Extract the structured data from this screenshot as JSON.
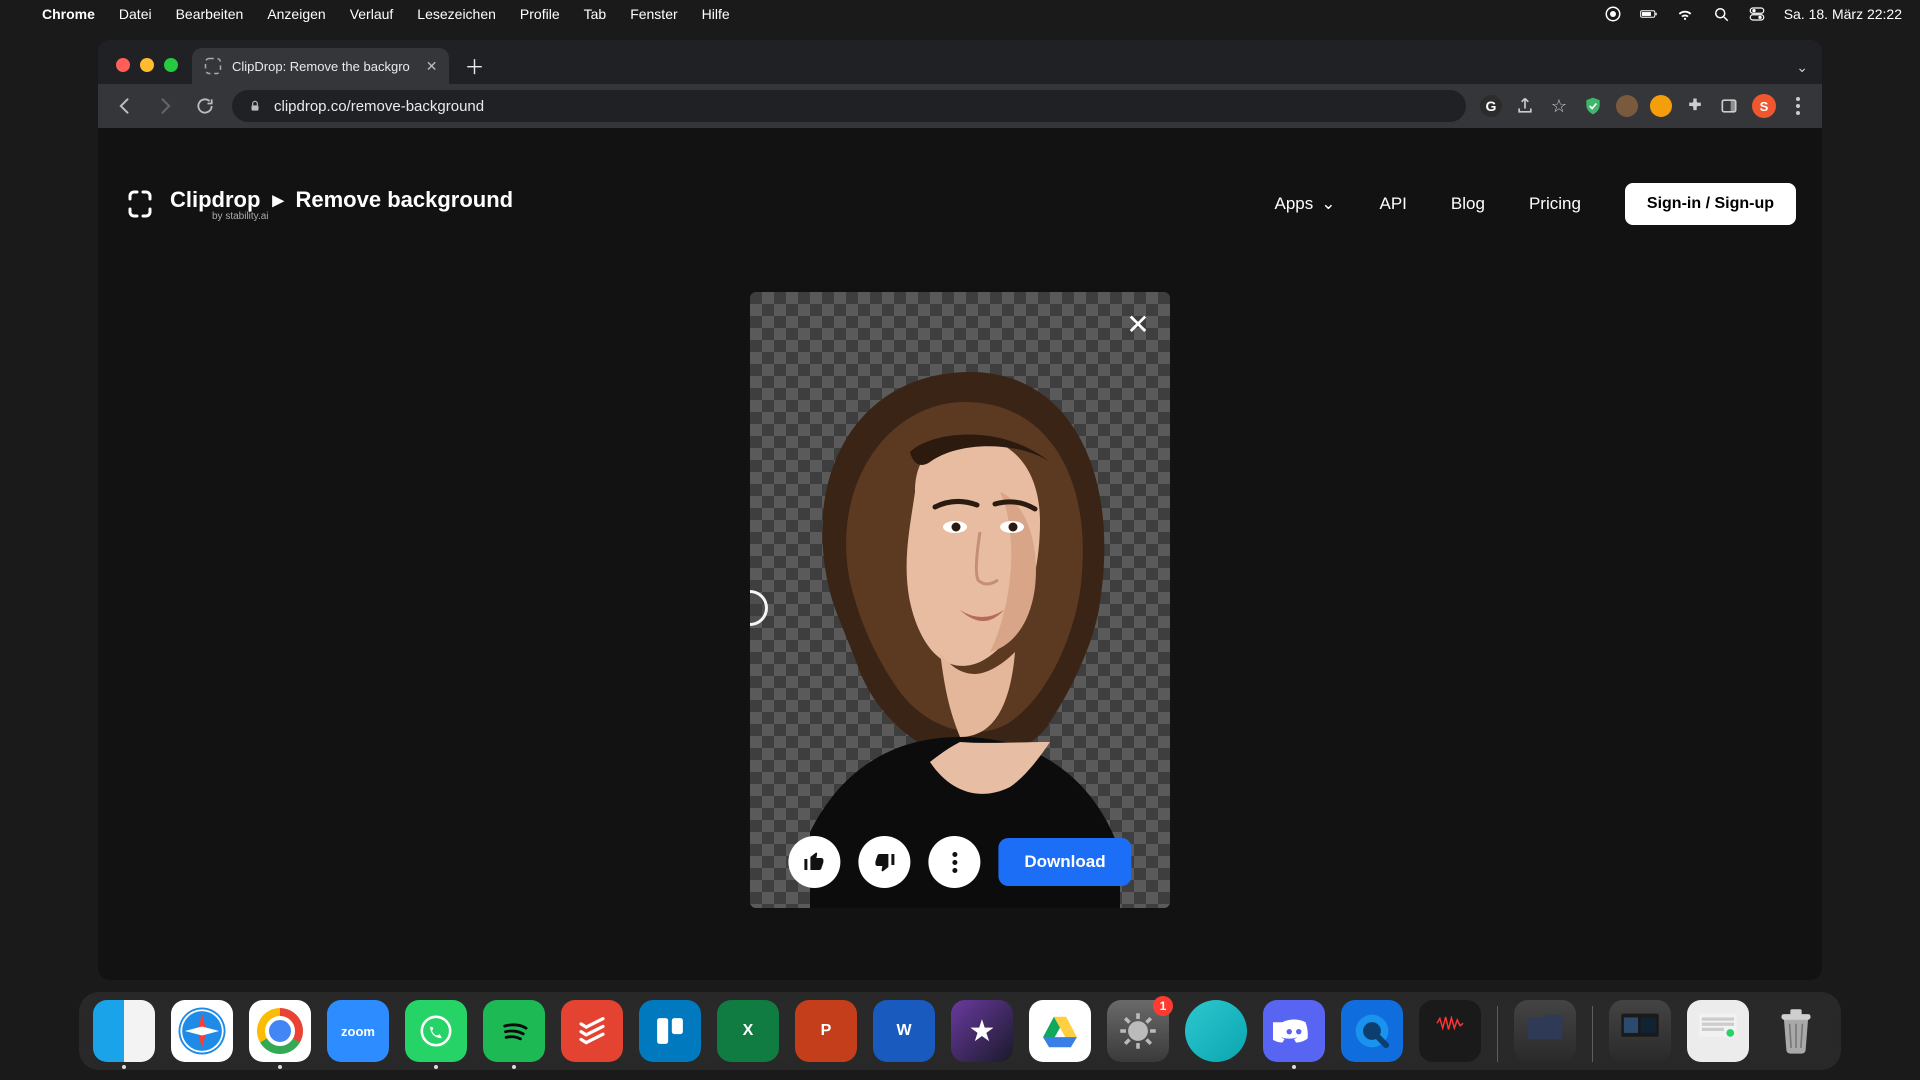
{
  "menubar": {
    "app": "Chrome",
    "menus": [
      "Datei",
      "Bearbeiten",
      "Anzeigen",
      "Verlauf",
      "Lesezeichen",
      "Profile",
      "Tab",
      "Fenster",
      "Hilfe"
    ],
    "clock": "Sa. 18. März  22:22"
  },
  "browser": {
    "tab_title": "ClipDrop: Remove the backgro",
    "url": "clipdrop.co/remove-background",
    "profile_initial": "S"
  },
  "site": {
    "brand": "Clipdrop",
    "crumb": "Remove background",
    "tagline": "by stability.ai",
    "nav": {
      "apps": "Apps",
      "api": "API",
      "blog": "Blog",
      "pricing": "Pricing"
    },
    "signin": "Sign-in / Sign-up"
  },
  "result": {
    "download": "Download"
  },
  "dock": {
    "zoom": "zoom",
    "excel": "X",
    "ppt": "P",
    "word": "W",
    "settings_badge": "1"
  }
}
